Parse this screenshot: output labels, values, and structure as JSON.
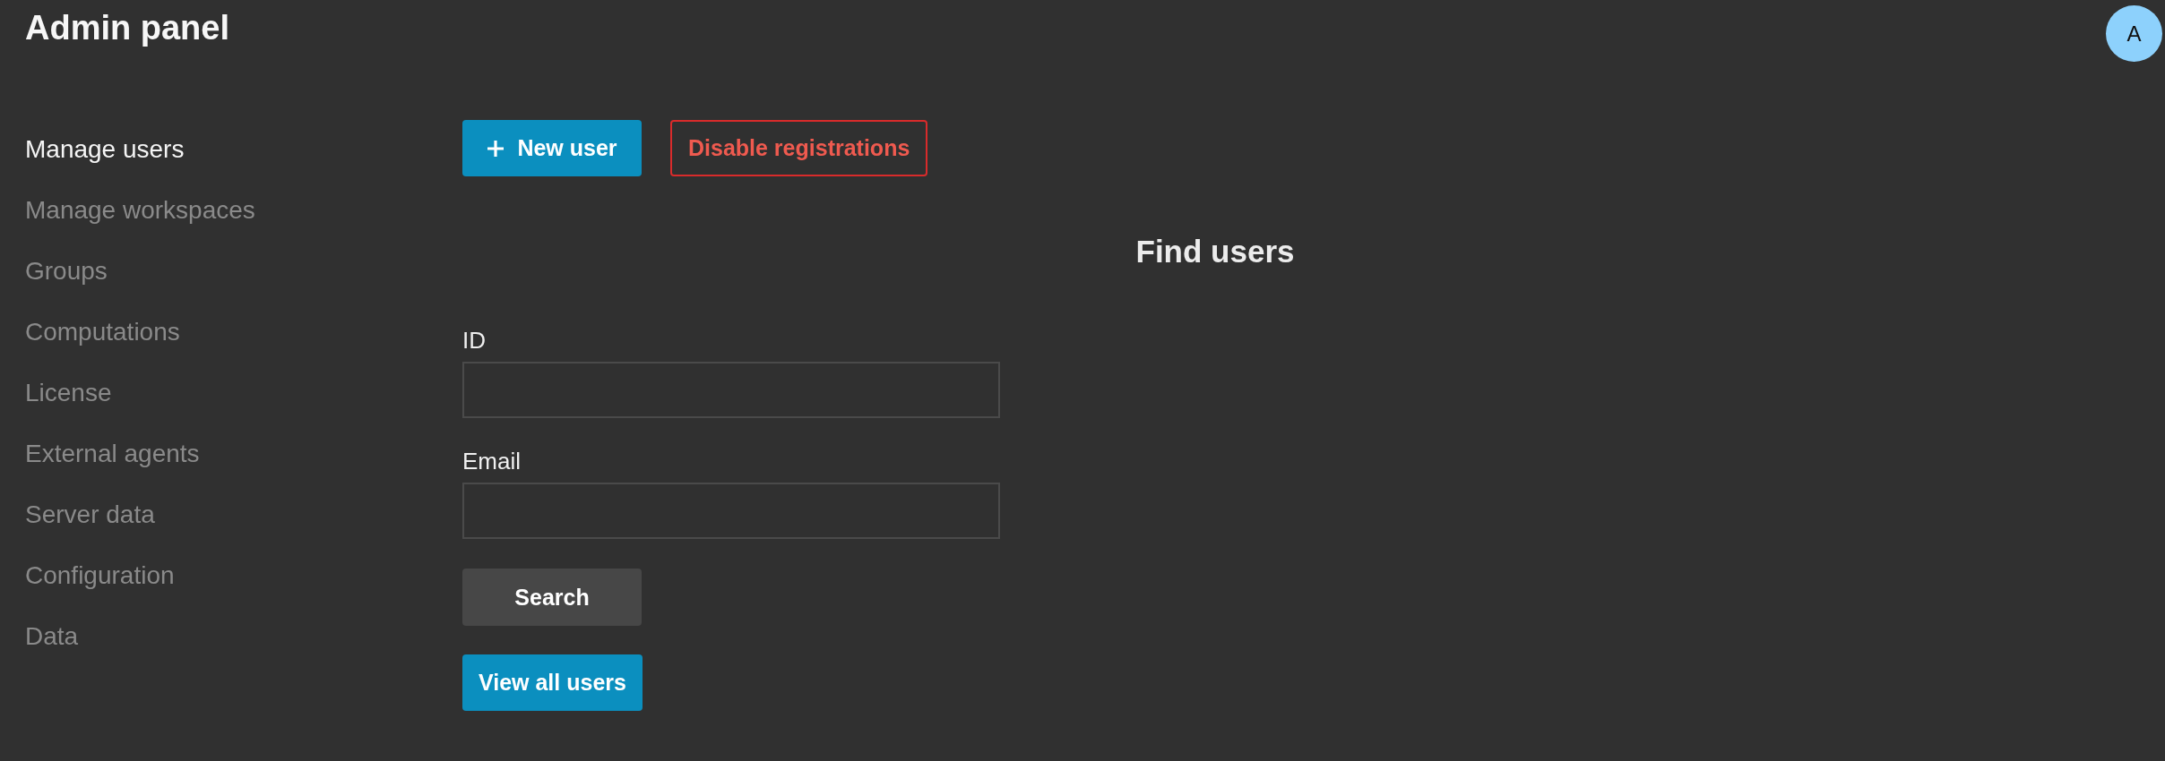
{
  "header": {
    "title": "Admin panel",
    "avatar": {
      "initial": "A"
    }
  },
  "sidebar": {
    "items": [
      {
        "label": "Manage users",
        "selected": true
      },
      {
        "label": "Manage workspaces",
        "selected": false
      },
      {
        "label": "Groups",
        "selected": false
      },
      {
        "label": "Computations",
        "selected": false
      },
      {
        "label": "License",
        "selected": false
      },
      {
        "label": "External agents",
        "selected": false
      },
      {
        "label": "Server data",
        "selected": false
      },
      {
        "label": "Configuration",
        "selected": false
      },
      {
        "label": "Data",
        "selected": false
      }
    ]
  },
  "toolbar": {
    "buttons": [
      {
        "label": "New user",
        "kind": "create"
      },
      {
        "label": "Disable registrations",
        "kind": "danger"
      }
    ]
  },
  "find_users": {
    "heading": "Find users",
    "fields": [
      {
        "label": "ID"
      },
      {
        "label": "Email"
      }
    ],
    "buttons": [
      {
        "label": "Search",
        "kind": "secondary"
      },
      {
        "label": "View all users",
        "kind": "primary"
      }
    ]
  }
}
